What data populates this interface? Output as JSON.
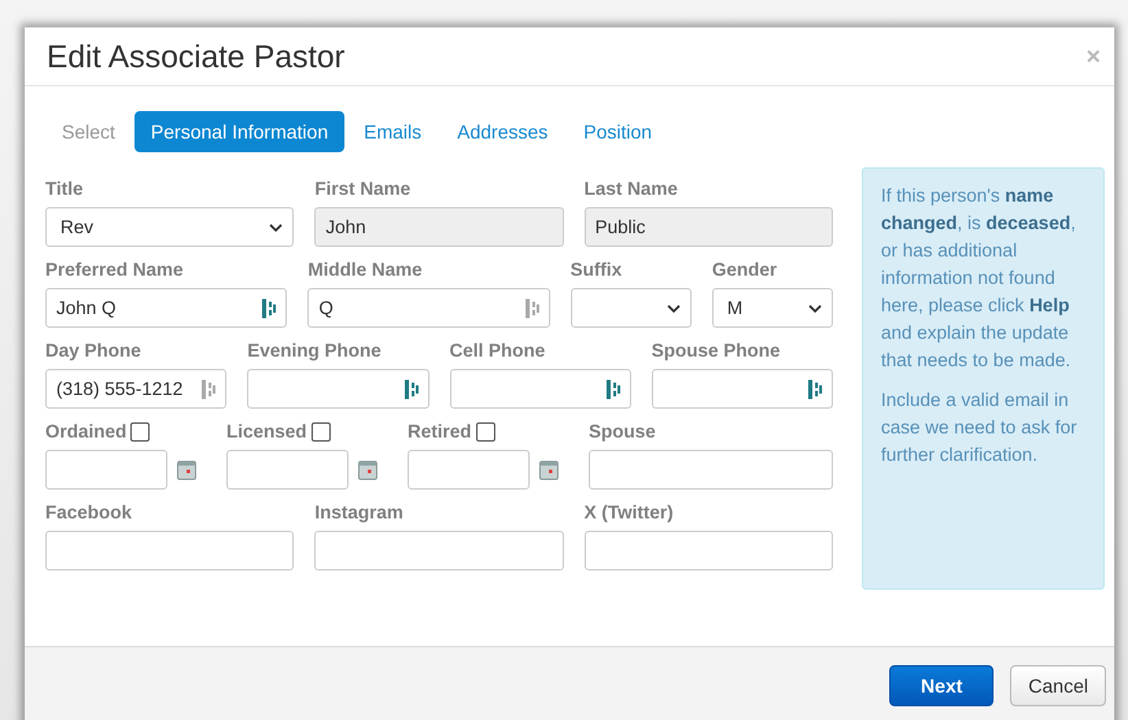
{
  "dialog": {
    "title": "Edit Associate Pastor",
    "close": "×"
  },
  "tabs": {
    "prefix": "Select",
    "items": [
      {
        "label": "Personal Information",
        "selected": true
      },
      {
        "label": "Emails",
        "selected": false
      },
      {
        "label": "Addresses",
        "selected": false
      },
      {
        "label": "Position",
        "selected": false
      }
    ]
  },
  "form": {
    "rows": [
      {
        "fields": [
          {
            "kind": "select",
            "label": "Title",
            "value": "Rev"
          },
          {
            "kind": "readonly",
            "label": "First Name",
            "value": "John"
          },
          {
            "kind": "readonly",
            "label": "Last Name",
            "value": "Public"
          }
        ]
      },
      {
        "fields": [
          {
            "kind": "text",
            "label": "Preferred Name",
            "value": "John Q",
            "icon_active": true
          },
          {
            "kind": "text",
            "label": "Middle Name",
            "value": "Q",
            "icon_active": false
          },
          {
            "kind": "select",
            "label": "Suffix"
          },
          {
            "kind": "select",
            "label": "Gender",
            "value": "M"
          }
        ]
      },
      {
        "fields": [
          {
            "kind": "text",
            "label": "Day Phone",
            "value": "(318) 555-1212",
            "icon_active": false
          },
          {
            "kind": "text",
            "label": "Evening Phone",
            "icon_active": true
          },
          {
            "kind": "text",
            "label": "Cell Phone",
            "icon_active": true
          },
          {
            "kind": "text",
            "label": "Spouse Phone",
            "icon_active": true
          }
        ]
      },
      {
        "fields": [
          {
            "kind": "date",
            "label": "Ordained",
            "checked": false
          },
          {
            "kind": "date",
            "label": "Licensed",
            "checked": false
          },
          {
            "kind": "date",
            "label": "Retired",
            "checked": false
          },
          {
            "kind": "plain",
            "label": "Spouse"
          }
        ]
      },
      {
        "fields": [
          {
            "kind": "plain",
            "label": "Facebook"
          },
          {
            "kind": "plain",
            "label": "Instagram"
          },
          {
            "kind": "plain",
            "label": "X (Twitter)"
          }
        ]
      }
    ]
  },
  "help": {
    "paragraphs": [
      "If this person's **name changed**, is **deceased**, or has additional information not found here, please click **Help** and explain the update that needs to be made.",
      "Include a valid email in case we need to ask for further clarification."
    ]
  },
  "buttons": [
    {
      "kind": "primary",
      "label": "Next"
    },
    {
      "kind": "default",
      "label": "Cancel"
    }
  ]
}
